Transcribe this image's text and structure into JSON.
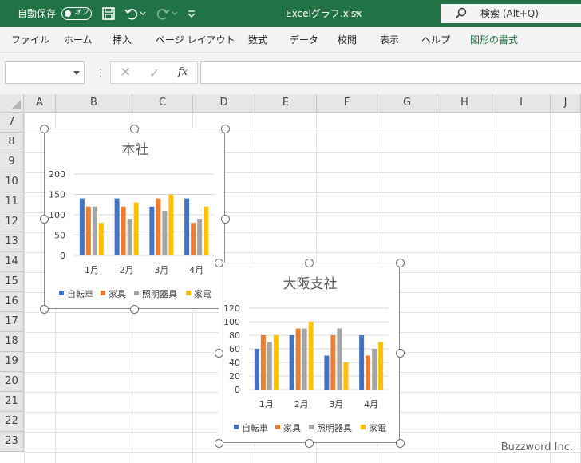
{
  "titlebar": {
    "autosave_label": "自動保存",
    "autosave_state": "オフ",
    "filename": "Excelグラフ.xlsx",
    "filename_chevron": "⌄",
    "search_label": "検索 (Alt+Q)",
    "icons": [
      "save-icon",
      "undo-icon",
      "redo-icon",
      "customize-toolbar-icon",
      "search-icon"
    ]
  },
  "ribbon": {
    "tabs": [
      "ファイル",
      "ホーム",
      "挿入",
      "ページ レイアウト",
      "数式",
      "データ",
      "校閲",
      "表示",
      "ヘルプ",
      "図形の書式"
    ],
    "accent": "#217346"
  },
  "formula_bar": {
    "namebox": "",
    "separator": "⋮",
    "cancel": "✕",
    "enter": "✓",
    "fx": "fx",
    "formula": ""
  },
  "grid": {
    "columns": [
      "A",
      "B",
      "C",
      "D",
      "E",
      "F",
      "G",
      "H",
      "I",
      "J"
    ],
    "rows": [
      "7",
      "8",
      "9",
      "10",
      "11",
      "12",
      "13",
      "14",
      "15",
      "16",
      "17",
      "18",
      "19",
      "20",
      "21",
      "22",
      "23"
    ]
  },
  "chart_data": [
    {
      "type": "bar",
      "title": "本社",
      "categories": [
        "1月",
        "2月",
        "3月",
        "4月"
      ],
      "series": [
        {
          "name": "自転車",
          "color": "#4472C4",
          "values": [
            140,
            140,
            120,
            140
          ]
        },
        {
          "name": "家具",
          "color": "#ED7D31",
          "values": [
            120,
            120,
            140,
            80
          ]
        },
        {
          "name": "照明器具",
          "color": "#A5A5A5",
          "values": [
            120,
            90,
            110,
            90
          ]
        },
        {
          "name": "家電",
          "color": "#FFC000",
          "values": [
            80,
            130,
            150,
            120
          ]
        }
      ],
      "yticks": [
        "0",
        "50",
        "100",
        "150",
        "200"
      ],
      "ylim": [
        0,
        200
      ],
      "grid": true,
      "legend": "bottom"
    },
    {
      "type": "bar",
      "title": "大阪支社",
      "categories": [
        "1月",
        "2月",
        "3月",
        "4月"
      ],
      "series": [
        {
          "name": "自転車",
          "color": "#4472C4",
          "values": [
            60,
            80,
            50,
            80
          ]
        },
        {
          "name": "家具",
          "color": "#ED7D31",
          "values": [
            80,
            90,
            80,
            50
          ]
        },
        {
          "name": "照明器具",
          "color": "#A5A5A5",
          "values": [
            70,
            90,
            90,
            60
          ]
        },
        {
          "name": "家電",
          "color": "#FFC000",
          "values": [
            80,
            100,
            40,
            70
          ]
        }
      ],
      "yticks": [
        "0",
        "20",
        "40",
        "60",
        "80",
        "100",
        "120"
      ],
      "ylim": [
        0,
        120
      ],
      "grid": true,
      "legend": "bottom"
    }
  ],
  "watermark": "Buzzword Inc."
}
